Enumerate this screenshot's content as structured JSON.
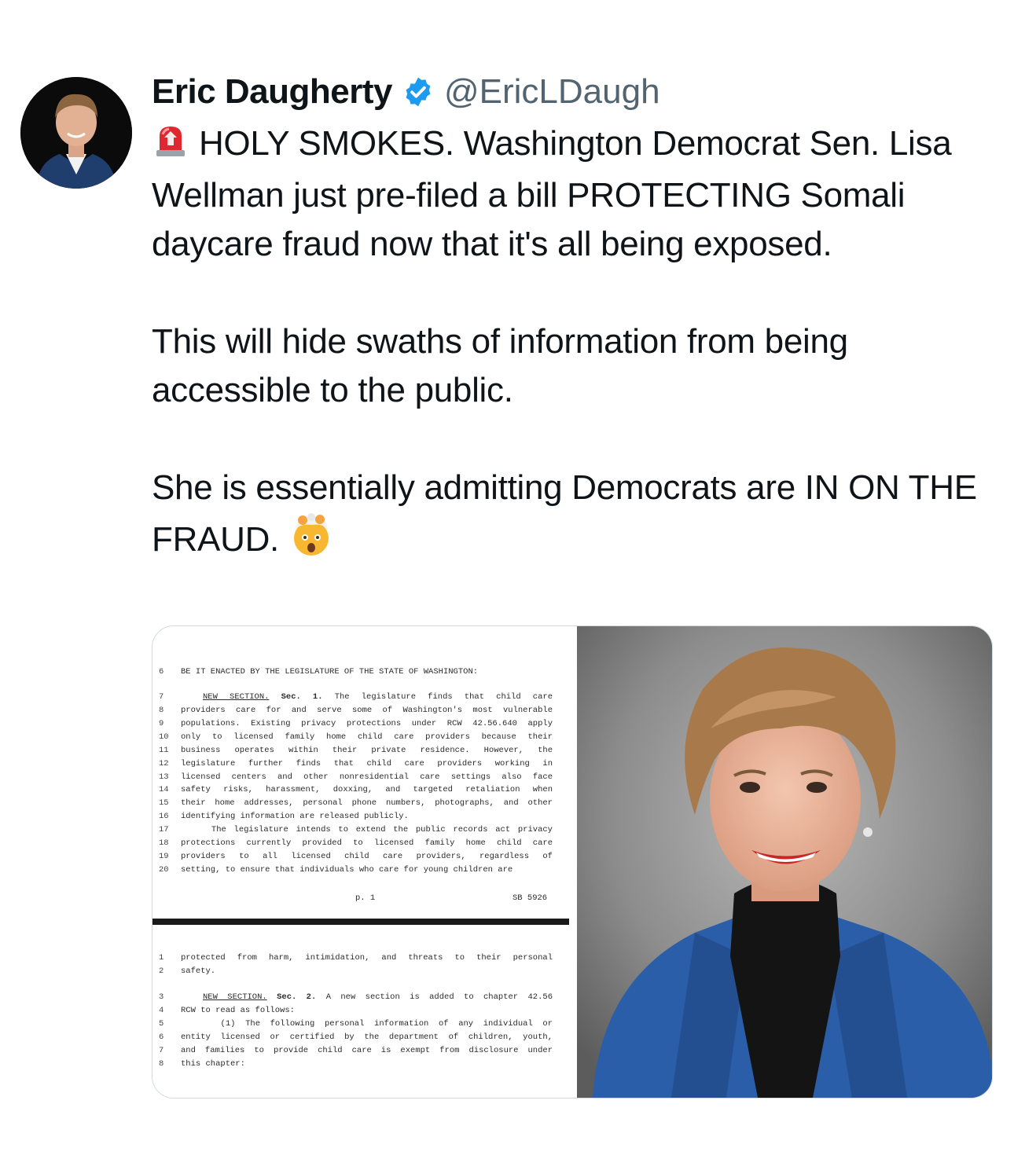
{
  "author": {
    "display_name": "Eric Daugherty",
    "handle": "@EricLDaugh",
    "verified_icon": "verified-badge-icon",
    "avatar_icon": "avatar"
  },
  "tweet": {
    "lines": [
      "HOLY SMOKES. Washington Democrat Sen. Lisa Wellman just pre-filed a bill PROTECTING Somali daycare fraud now that it's all being exposed.",
      "This will hide swaths of information from being accessible to the public.",
      "She is essentially admitting Democrats are IN ON THE FRAUD."
    ],
    "emoji_start": "police-light-emoji",
    "emoji_end": "exploding-head-emoji"
  },
  "document": {
    "page1": {
      "header_num": "6",
      "header": "BE IT ENACTED BY THE LEGISLATURE OF THE STATE OF WASHINGTON:",
      "section_label": "NEW SECTION.",
      "section_sec": "Sec. 1.",
      "line7_rest": "The legislature finds that child care",
      "lines": [
        {
          "n": "8",
          "t": "providers care for and serve some of Washington's most vulnerable"
        },
        {
          "n": "9",
          "t": "populations. Existing privacy protections under RCW 42.56.640 apply"
        },
        {
          "n": "10",
          "t": "only to licensed family home child care providers because their"
        },
        {
          "n": "11",
          "t": "business operates within their private residence. However, the"
        },
        {
          "n": "12",
          "t": "legislature further finds that child care providers working in"
        },
        {
          "n": "13",
          "t": "licensed centers and other nonresidential care settings also face"
        },
        {
          "n": "14",
          "t": "safety risks, harassment, doxxing, and targeted retaliation when"
        },
        {
          "n": "15",
          "t": "their home addresses, personal phone numbers, photographs, and other"
        },
        {
          "n": "16",
          "t": "identifying information are released publicly."
        },
        {
          "n": "17",
          "t": "    The legislature intends to extend the public records act privacy"
        },
        {
          "n": "18",
          "t": "protections currently provided to licensed family home child care"
        },
        {
          "n": "19",
          "t": "providers to all licensed child care providers, regardless of"
        },
        {
          "n": "20",
          "t": "setting, to ensure that individuals who care for young children are"
        }
      ],
      "page_label": "p. 1",
      "bill_label": "SB 5926"
    },
    "page2": {
      "lines_a": [
        {
          "n": "1",
          "t": "protected from harm, intimidation, and threats to their personal"
        },
        {
          "n": "2",
          "t": "safety."
        }
      ],
      "section_label": "NEW SECTION.",
      "section_sec": "Sec. 2.",
      "line3_num": "3",
      "line3_rest": "A new section is added to chapter 42.56",
      "lines_b": [
        {
          "n": "4",
          "t": "RCW to read as follows:"
        },
        {
          "n": "5",
          "t": "    (1) The following personal information of any individual or"
        },
        {
          "n": "6",
          "t": "entity licensed or certified by the department of children, youth,"
        },
        {
          "n": "7",
          "t": "and families to provide child care is exempt from disclosure under"
        },
        {
          "n": "8",
          "t": "this chapter:"
        }
      ]
    }
  },
  "photo": {
    "icon": "portrait-photo",
    "colors": {
      "background": "#8c8c8c",
      "hair": "#a8794a",
      "jacket": "#2a5ea8",
      "turtleneck": "#141414"
    }
  },
  "colors": {
    "text": "#0f1419",
    "muted": "#536471",
    "verified": "#1d9bf0",
    "border": "#cfd9de"
  }
}
